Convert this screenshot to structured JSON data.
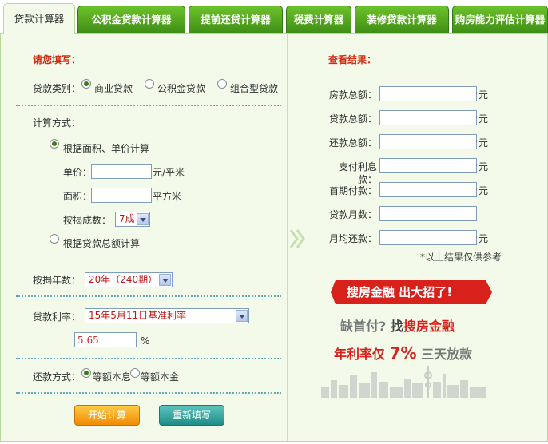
{
  "tabs": [
    "贷款计算器",
    "公积金贷款计算器",
    "提前还贷计算器",
    "税费计算器",
    "装修贷款计算器",
    "购房能力评估计算器"
  ],
  "form": {
    "title": "请您填写：",
    "loan_type_label": "贷款类别：",
    "loan_types": [
      "商业贷款",
      "公积金贷款",
      "组合型贷款"
    ],
    "calc_method_label": "计算方式：",
    "method_area": "根据面积、单价计算",
    "unit_price_label": "单价：",
    "unit_price_unit": "元/平米",
    "area_label": "面积：",
    "area_unit": "平方米",
    "ratio_label": "按揭成数：",
    "ratio_value": "7成",
    "method_total": "根据贷款总额计算",
    "years_label": "按揭年数：",
    "years_value": "20年（240期）",
    "rate_label": "贷款利率：",
    "rate_value": "15年5月11日基准利率",
    "rate_input": "5.65",
    "rate_unit": "%",
    "repay_label": "还款方式：",
    "repay_options": [
      "等额本息",
      "等额本金"
    ],
    "calc_button": "开始计算",
    "reset_button": "重新填写"
  },
  "results": {
    "title": "查看结果：",
    "rows": [
      {
        "label": "房款总额：",
        "unit": "元"
      },
      {
        "label": "贷款总额：",
        "unit": "元"
      },
      {
        "label": "还款总额：",
        "unit": "元"
      },
      {
        "label": "支付利息款：",
        "unit": "元"
      },
      {
        "label": "首期付款：",
        "unit": "元"
      },
      {
        "label": "贷款月数：",
        "unit": ""
      },
      {
        "label": "月均还款：",
        "unit": "元"
      }
    ],
    "note": "*以上结果仅供参考"
  },
  "ad": {
    "banner": "搜房金融   出大招了!",
    "line1a": "缺首付?",
    "line1b": "找",
    "line1c": "搜房金融",
    "line2a": "年利率仅",
    "line2b": "7%",
    "line2c": "三天放款"
  },
  "colors": {
    "tab_green": "#4ea21c",
    "accent_red": "#d42a12",
    "panel_bg": "#f3faea"
  }
}
